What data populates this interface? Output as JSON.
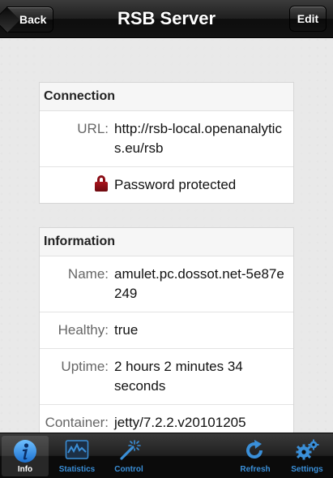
{
  "navbar": {
    "title": "RSB Server",
    "back_label": "Back",
    "edit_label": "Edit"
  },
  "sections": {
    "connection": {
      "header": "Connection",
      "url_label": "URL:",
      "url_value": "http://rsb-local.openanalytics.eu/rsb",
      "password_text": "Password protected"
    },
    "information": {
      "header": "Information",
      "name_label": "Name:",
      "name_value": "amulet.pc.dossot.net-5e87e249",
      "healthy_label": "Healthy:",
      "healthy_value": "true",
      "uptime_label": "Uptime:",
      "uptime_value": "2 hours 2 minutes 34 seconds",
      "container_label": "Container:",
      "container_value": "jetty/7.2.2.v20101205"
    }
  },
  "tabbar": {
    "info": "Info",
    "statistics": "Statistics",
    "control": "Control",
    "refresh": "Refresh",
    "settings": "Settings",
    "active": "info"
  },
  "colors": {
    "tab_icon": "#3a8fd8",
    "lock": "#8b0e16"
  }
}
